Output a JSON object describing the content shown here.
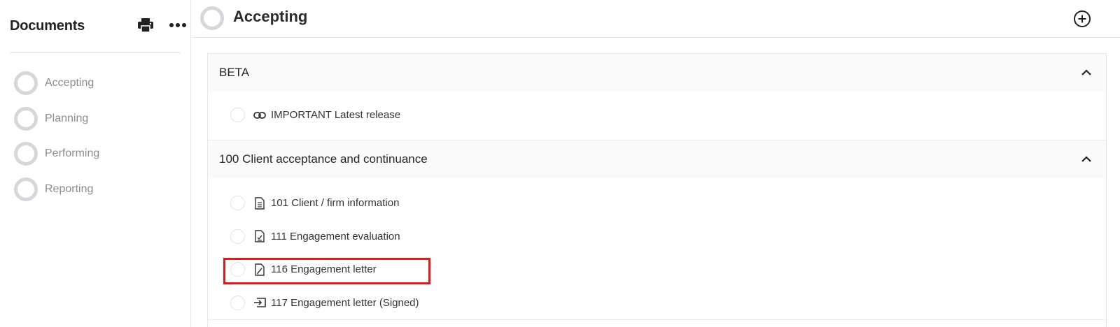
{
  "sidebar": {
    "title": "Documents",
    "actions": [
      {
        "icon": "printer-icon"
      },
      {
        "icon": "more-horizontal-icon"
      }
    ],
    "phases": [
      {
        "label": "Accepting"
      },
      {
        "label": "Planning"
      },
      {
        "label": "Performing"
      },
      {
        "label": "Reporting"
      }
    ]
  },
  "header": {
    "title": "Accepting",
    "add_icon": "plus-circle-icon"
  },
  "sections": [
    {
      "title": "BETA",
      "expanded": true,
      "items": [
        {
          "label": "IMPORTANT Latest release",
          "icon": "link-icon"
        }
      ]
    },
    {
      "title": "100 Client acceptance and continuance",
      "expanded": true,
      "items": [
        {
          "label": "101 Client / firm information",
          "icon": "document-list-icon"
        },
        {
          "label": "111 Engagement evaluation",
          "icon": "document-check-icon"
        },
        {
          "label": "116 Engagement letter",
          "icon": "document-edit-icon",
          "highlighted": true
        },
        {
          "label": "117 Engagement letter (Signed)",
          "icon": "import-icon"
        }
      ]
    }
  ],
  "colors": {
    "highlight": "#e01919",
    "ring": "#d4d7db",
    "muted_text": "#8c8c8c"
  }
}
